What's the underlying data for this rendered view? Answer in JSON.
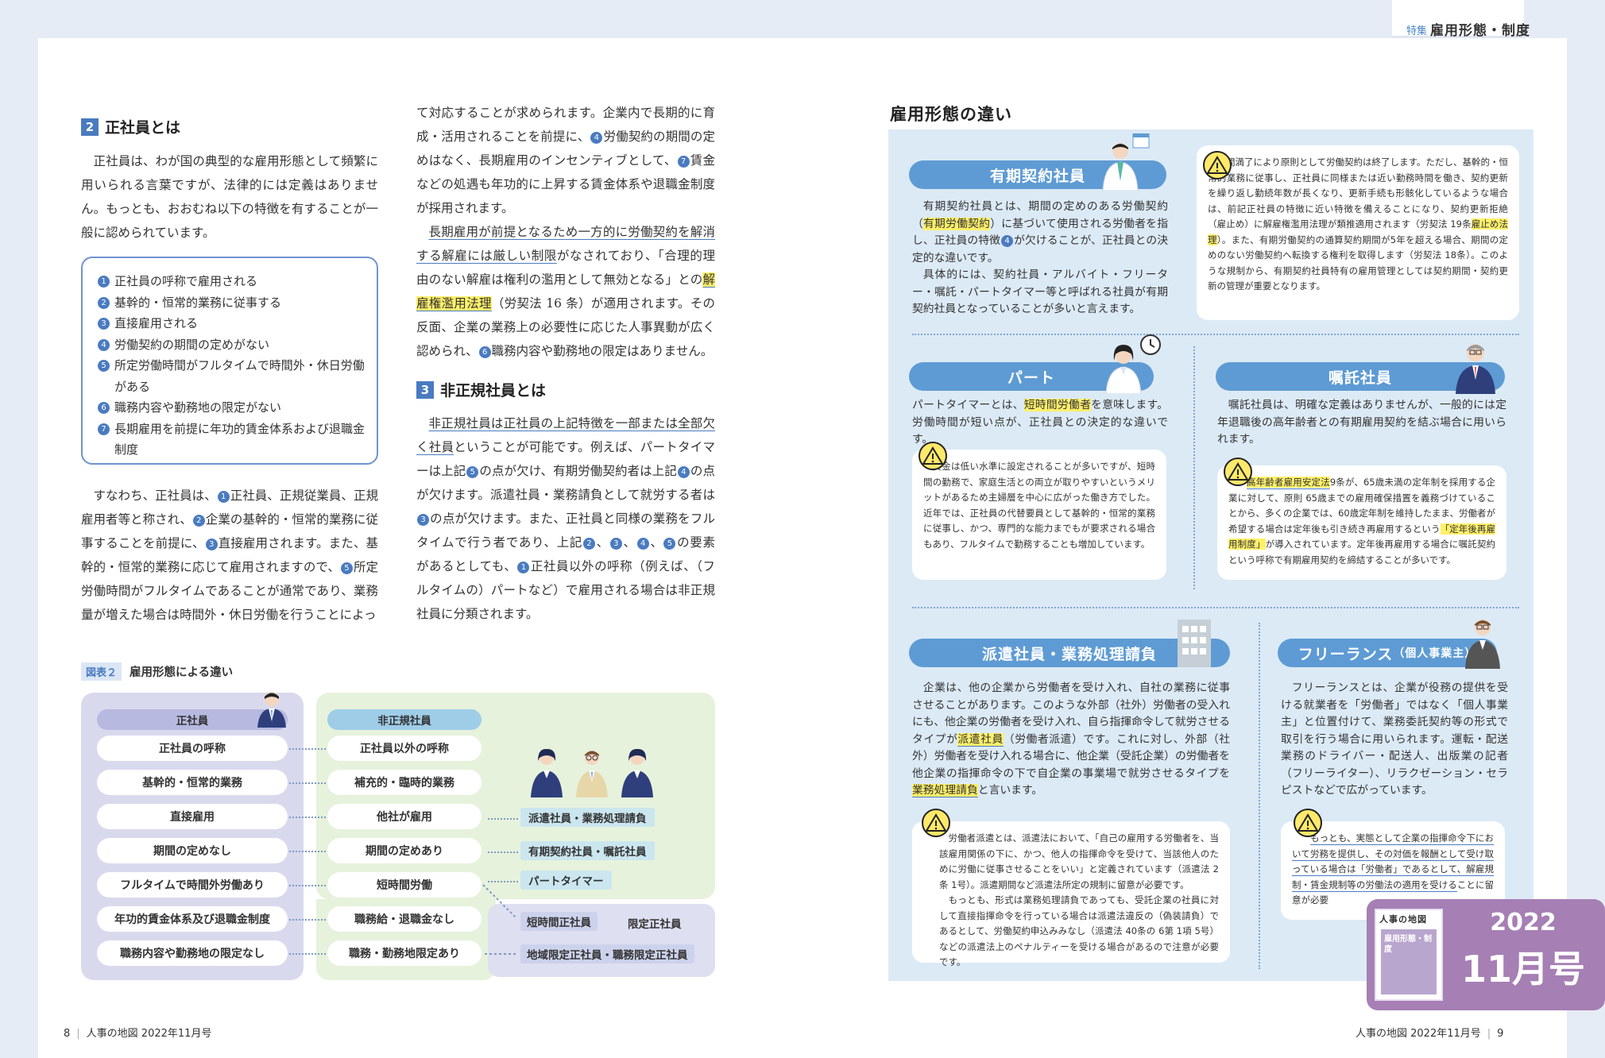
{
  "header": {
    "tag": "特集",
    "title": "雇用形態・制度"
  },
  "left": {
    "sec2": {
      "num": "2",
      "title": "正社員とは"
    },
    "sec2_p1": "正社員は、わが国の典型的な雇用形態として頻繁に用いられる言葉ですが、法律的には定義はありません。もっとも、おおむね以下の特徴を有することが一般に認められています。",
    "features": [
      {
        "n": "1",
        "text": "正社員の呼称で雇用される"
      },
      {
        "n": "2",
        "text": "基幹的・恒常的業務に従事する"
      },
      {
        "n": "3",
        "text": "直接雇用される"
      },
      {
        "n": "4",
        "text": "労働契約の期間の定めがない"
      },
      {
        "n": "5",
        "text": "所定労働時間がフルタイムで時間外・休日労働がある"
      },
      {
        "n": "6",
        "text": "職務内容や勤務地の限定がない"
      },
      {
        "n": "7",
        "text": "長期雇用を前提に年功的賃金体系および退職金制度"
      }
    ],
    "sec2_p2": {
      "a": "すなわち、正社員は、",
      "b": "正社員、正規従業員、正規雇用者等と称され、",
      "c": "企業の基幹的・恒常的業務に従事することを前提に、",
      "d": "直接雇用されます。また、基幹的・恒常的業務に応じて雇用されますので、",
      "e": "所定労働時間がフルタイムであることが通常であり、業務量が増えた場合は時間外・休日労働を行うことによっ"
    },
    "col2_p1": {
      "a": "て対応することが求められます。企業内で長期的に育成・活用されることを前提に、",
      "b": "労働契約の期間の定めはなく、長期雇用のインセンティブとして、",
      "c": "賃金などの処遇も年功的に上昇する賃金体系や退職金制度が採用されます。"
    },
    "col2_p2": {
      "u1": "長期雇用が前提となるため一方的に労働契約を解消する解雇には厳しい制限",
      "a": "がなされており、「合理的理由のない解雇は権利の濫用として無効となる」との",
      "h1": "解雇権濫用法理",
      "b": "（労契法 16 条）が適用されます。その反面、企業の業務上の必要性に応じた人事異動が広く認められ、",
      "c": "職務内容や勤務地の限定はありません。"
    },
    "sec3": {
      "num": "3",
      "title": "非正規社員とは"
    },
    "sec3_p": {
      "u1": "非正規社員は正社員の上記特徴を一部または全部欠く社員",
      "a": "ということが可能です。例えば、パートタイマーは上記",
      "b": "の点が欠け、有期労働契約者は上記",
      "c": "の点が欠けます。派遣社員・業務請負として就労する者は",
      "d": "の点が欠けます。また、正社員と同様の業務をフルタイムで行う者であり、上記",
      "e": "の要素があるとしても、",
      "f": "正社員以外の呼称（例えば、（フルタイムの）パートなど）で雇用される場合は非正規社員に分類されます。"
    }
  },
  "figure": {
    "tag": "図表２",
    "title": "雇用形態による違い",
    "regular_head": "正社員",
    "nonregular_head": "非正規社員",
    "regular": [
      "正社員の呼称",
      "基幹的・恒常的業務",
      "直接雇用",
      "期間の定めなし",
      "フルタイムで時間外労働あり",
      "年功的賃金体系及び退職金制度",
      "職務内容や勤務地の限定なし"
    ],
    "nonregular": [
      "正社員以外の呼称",
      "補充的・臨時的業務",
      "他社が雇用",
      "期間の定めあり",
      "短時間労働",
      "職務給・退職金なし",
      "職務・勤務地限定あり"
    ],
    "types": [
      "派遣社員・業務処理請負",
      "有期契約社員・嘱託社員",
      "パートタイマー"
    ],
    "sub": {
      "short": "短時間正社員",
      "limited": "限定正社員",
      "area": "地域限定正社員・職務限定正社員"
    }
  },
  "right": {
    "title": "雇用形態の違い",
    "fixed": {
      "head": "有期契約社員",
      "t1": "有期契約社員とは、期間の定めのある労働契約（",
      "h": "有期労働契約",
      "t2": "）に基づいて使用される労働者を指し、正社員の特徴",
      "t3": "が欠けることが、正社員との決定的な違いです。",
      "t4": "具体的には、契約社員・アルバイト・フリーター・嘱託・パートタイマー等と呼ばれる社員が有期契約社員となっていることが多いと言えます。",
      "note1": "期間満了により原則として労働契約は終了します。ただし、基幹的・恒常的業務に従事し、正社員に同様または近い勤務時間を働き、契約更新を繰り返し勤続年数が長くなり、更新手続も形骸化しているような場合は、前記正社員の特徴に近い特徴を備えることになり、契約更新拒絶（雇止め）に解雇権濫用法理が類推適用されます（労契法 19条",
      "note_h": "雇止め法理",
      "note2": "）。また、有期労働契約の通算契約期間が5年を超える場合、期間の定めのない労働契約へ転換する権利を取得します（労契法 18条）。このような規制から、有期契約社員特有の雇用管理としては契約期間・契約更新の管理が重要となります。"
    },
    "part": {
      "head": "パート",
      "t1": "パートタイマーとは、",
      "h": "短時間労働者",
      "t2": "を意味します。労働時間が短い点が、正社員との決定的な違いです。",
      "note": "賃金は低い水準に設定されることが多いですが、短時間の勤務で、家庭生活との両立が取りやすいというメリットがあるため主婦層を中心に広がった働き方でした。近年では、正社員の代替要員として基幹的・恒常的業務に従事し、かつ、専門的な能力までもが要求される場合もあり、フルタイムで勤務することも増加しています。"
    },
    "shokutaku": {
      "head": "嘱託社員",
      "t": "嘱託社員は、明確な定義はありませんが、一般的には定年退職後の高年齢者との有期雇用契約を結ぶ場合に用いられます。",
      "note_h1": "高年齢者雇用安定法",
      "note1": "9条が、65歳未満の定年制を採用する企業に対して、原則 65歳までの雇用確保措置を義務づけていることから、多くの企業では、60歳定年制を維持したまま、労働者が希望する場合は定年後も引き続き再雇用するという",
      "note_h2": "「定年後再雇用制度」",
      "note2": "が導入されています。定年後再雇用する場合に嘱託契約という呼称で有期雇用契約を締結することが多いです。"
    },
    "haken": {
      "head": "派遣社員・業務処理請負",
      "t1": "企業は、他の企業から労働者を受け入れ、自社の業務に従事させることがあります。このような外部（社外）労働者の受入れにも、他企業の労働者を受け入れ、自ら指揮命令して就労させるタイプが",
      "h1": "派遣社員",
      "t2": "（労働者派遣）です。これに対し、外部（社外）労働者を受け入れる場合に、他企業（受託企業）の労働者を他企業の指揮命令の下で自企業の事業場で就労させるタイプを",
      "h2": "業務処理請負",
      "t3": "と言います。",
      "note1": "労働者派遣とは、派遣法において、「自己の雇用する労働者を、当該雇用関係の下に、かつ、他人の指揮命令を受けて、当該他人のために労働に従事させることをいい」と定義されています（派遣法 2条 1号）。派遣期間など派遣法所定の規制に留意が必要です。",
      "note2": "もっとも、形式は業務処理請負であっても、受託企業の社員に対して直接指揮命令を行っている場合は派遣法違反の（偽装請負）であるとして、労働契約申込みみなし（派遣法 40条の 6第 1項 5号）などの派遣法上のペナルティーを受ける場合があるので注意が必要です。"
    },
    "free": {
      "head": "フリーランス",
      "head_small": "（個人事業主）",
      "t": "フリーランスとは、企業が役務の提供を受ける就業者を「労働者」ではなく「個人事業主」と位置付けて、業務委託契約等の形式で取引を行う場合に用いられます。運転・配送業務のドライバー・配送人、出版業の記者（フリーライター）、リラクゼーション・セラピストなどで広がっています。",
      "note_u": "もっとも、実態として企業の指揮命令下において労務を提供し、その対価を報酬として受け取っている場合は「労働者」であるとして、解雇規制・賃金規制等の労働法の適用を受ける",
      "note_t": "ことに留意が必要"
    }
  },
  "footer": {
    "left_page": "8",
    "left_text": "人事の地図  2022年11月号",
    "right_text": "人事の地図  2022年11月号",
    "right_page": "9"
  },
  "badge": {
    "year": "2022",
    "month": "11月号",
    "cover_title": "人事の地図",
    "cover_sub": "雇用形態・制度"
  },
  "colors": {
    "accent": "#4a7bc0",
    "panel": "#dceaf6",
    "pill": "#5e9bd4",
    "highlight": "#fff06a",
    "badge": "#a67fb4"
  }
}
